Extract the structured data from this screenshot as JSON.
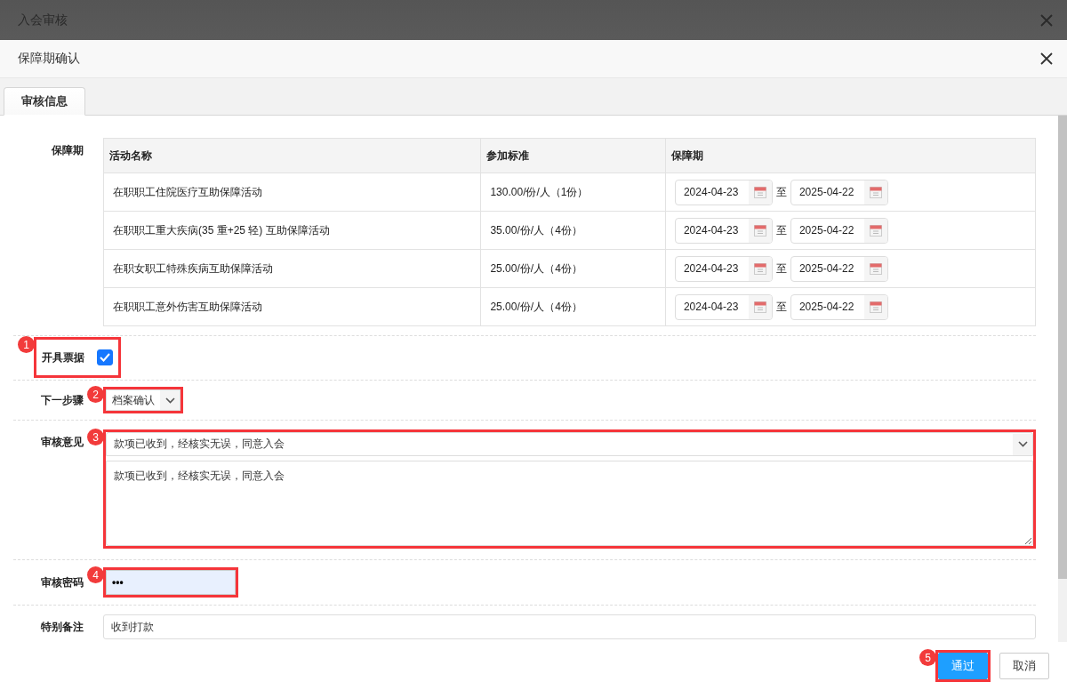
{
  "dialog_title": "入会审核",
  "form_title": "保障期确认",
  "tabs": [
    {
      "label": "审核信息",
      "selected": true
    }
  ],
  "coverage": {
    "label": "保障期",
    "columns": [
      "活动名称",
      "参加标准",
      "保障期"
    ],
    "rows": [
      {
        "name": "在职职工住院医疗互助保障活动",
        "standard": "130.00/份/人（1份）",
        "start": "2024-04-23",
        "separator": "至",
        "end": "2025-04-22"
      },
      {
        "name": "在职职工重大疾病(35 重+25 轻) 互助保障活动",
        "standard": "35.00/份/人（4份）",
        "start": "2024-04-23",
        "separator": "至",
        "end": "2025-04-22"
      },
      {
        "name": "在职女职工特殊疾病互助保障活动",
        "standard": "25.00/份/人（4份）",
        "start": "2024-04-23",
        "separator": "至",
        "end": "2025-04-22"
      },
      {
        "name": "在职职工意外伤害互助保障活动",
        "standard": "25.00/份/人（4份）",
        "start": "2024-04-23",
        "separator": "至",
        "end": "2025-04-22"
      }
    ]
  },
  "invoice": {
    "label": "开具票据",
    "checked": true,
    "callout": "1"
  },
  "next_step": {
    "label": "下一步骤",
    "value": "档案确认",
    "callout": "2"
  },
  "opinion": {
    "label": "审核意见",
    "preset": "款项已收到，经核实无误，同意入会",
    "value": "款项已收到，经核实无误，同意入会",
    "callout": "3"
  },
  "password": {
    "label": "审核密码",
    "value": "•••",
    "callout": "4"
  },
  "remarks": {
    "label": "特别备注",
    "value": "收到打款"
  },
  "buttons": [
    {
      "label": "通过",
      "kind": "primary",
      "callout": "5"
    },
    {
      "label": "取消",
      "kind": "default"
    }
  ]
}
